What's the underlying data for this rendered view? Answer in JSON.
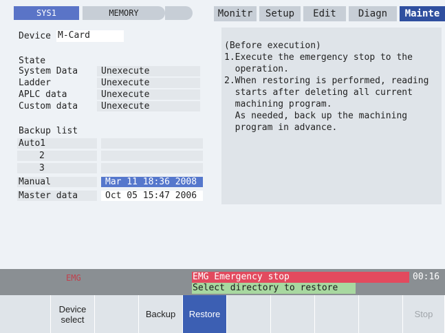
{
  "header": {
    "system_tab": "SYS1",
    "mode_tab": "MEMORY",
    "menus": [
      "Monitr",
      "Setup",
      "Edit",
      "Diagn",
      "Mainte"
    ]
  },
  "device": {
    "label": "Device",
    "value": "M-Card"
  },
  "state": {
    "title": "State",
    "rows": [
      {
        "name": "System Data",
        "value": "Unexecute"
      },
      {
        "name": "Ladder",
        "value": "Unexecute"
      },
      {
        "name": "APLC data",
        "value": "Unexecute"
      },
      {
        "name": "Custom data",
        "value": "Unexecute"
      }
    ]
  },
  "backup": {
    "title": "Backup list",
    "rows": [
      {
        "name": "Auto1",
        "value": ""
      },
      {
        "name": "2",
        "value": ""
      },
      {
        "name": "3",
        "value": ""
      },
      {
        "name": "Manual",
        "value": "Mar 11 18:36 2008"
      },
      {
        "name": "Master data",
        "value": "Oct 05 15:47 2006"
      }
    ]
  },
  "guide": {
    "lines": [
      "(Before execution)",
      "1.Execute the emergency stop to the",
      "  operation.",
      "2.When restoring is performed, reading",
      "  starts after deleting all current",
      "  machining program.",
      "  As needed, back up the machining",
      "  program in advance."
    ]
  },
  "status": {
    "emg_dim": "EMG",
    "alarm": "EMG  Emergency stop",
    "message": "Select directory to restore",
    "time": "00:16"
  },
  "function_keys": [
    "",
    "Device\nselect",
    "",
    "Backup",
    "Restore",
    "",
    "",
    "",
    "",
    "Stop"
  ],
  "colors": {
    "accent_blue": "#3c5fb3",
    "selected_row": "#5577cc",
    "alarm_red": "#e24a5e",
    "message_green": "#a8d8a0",
    "status_bar": "#8a8f93"
  }
}
